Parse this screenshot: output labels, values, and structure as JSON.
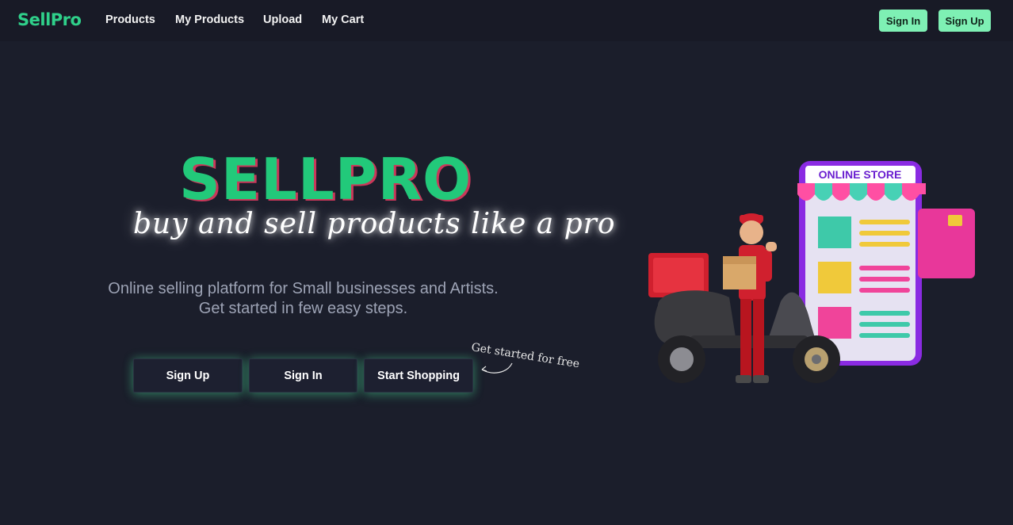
{
  "navbar": {
    "brand": "SellPro",
    "links": [
      "Products",
      "My Products",
      "Upload",
      "My Cart"
    ],
    "sign_in_label": "Sign In",
    "sign_up_label": "Sign Up"
  },
  "hero": {
    "title": "SELLPRO",
    "tagline": "buy and sell products like a pro",
    "description_line1": "Online selling platform for Small businesses and Artists.",
    "description_line2": "Get started in few easy steps.",
    "buttons": {
      "sign_up": "Sign Up",
      "sign_in": "Sign In",
      "start_shopping": "Start Shopping"
    },
    "annotation": "Get started for free"
  },
  "illustration": {
    "store_sign": "ONLINE STORE"
  },
  "colors": {
    "background": "#1b1e2b",
    "navbar": "#181a26",
    "brand": "#2fd08a",
    "nav_button": "#7ef0b4",
    "title": "#22c97a",
    "title_shadow": "#c9385a",
    "description": "#9da3b5"
  },
  "icons": [
    "curved-arrow-icon",
    "delivery-illustration"
  ]
}
